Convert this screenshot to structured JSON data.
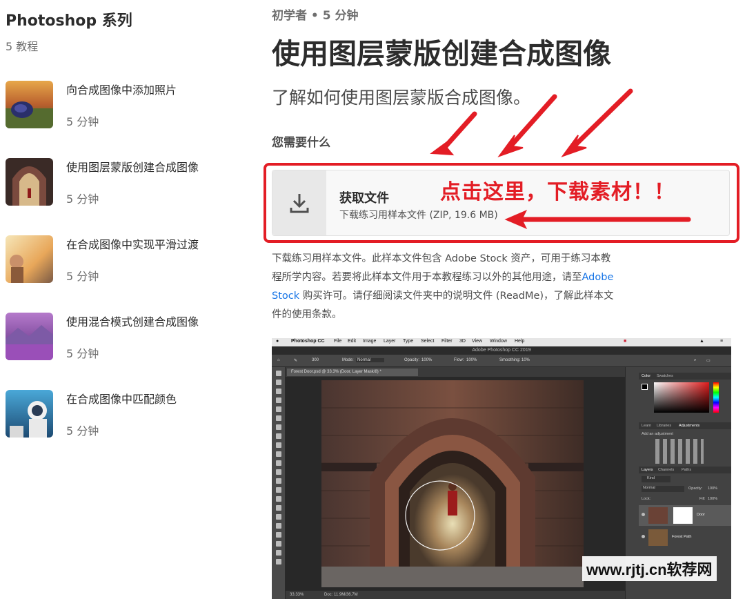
{
  "sidebar": {
    "title": "Photoshop 系列",
    "count": "5 教程",
    "lessons": [
      {
        "title": "向合成图像中添加照片",
        "time": "5 分钟"
      },
      {
        "title": "使用图层蒙版创建合成图像",
        "time": "5 分钟"
      },
      {
        "title": "在合成图像中实现平滑过渡",
        "time": "5 分钟"
      },
      {
        "title": "使用混合模式创建合成图像",
        "time": "5 分钟"
      },
      {
        "title": "在合成图像中匹配颜色",
        "time": "5 分钟"
      }
    ]
  },
  "main": {
    "meta": "初学者 • 5 分钟",
    "title": "使用图层蒙版创建合成图像",
    "lead": "了解如何使用图层蒙版合成图像。",
    "need": "您需要什么",
    "download": {
      "title": "获取文件",
      "subtitle": "下载练习用样本文件 (ZIP, 19.6 MB)",
      "icon": "download-icon"
    },
    "annotation": "点击这里，下载素材！！",
    "description": {
      "part1": "下载练习用样本文件。此样本文件包含 Adobe Stock 资产，可用于练习本教程所学内容。若要将此样本文件用于本教程练习以外的其他用途，请至",
      "link": "Adobe Stock",
      "part2": "购买许可。请仔细阅读文件夹中的说明文件 (ReadMe)，了解此样本文件的使用条款。"
    }
  },
  "ps": {
    "menu": [
      "Photoshop CC",
      "File",
      "Edit",
      "Image",
      "Layer",
      "Type",
      "Select",
      "Filter",
      "3D",
      "View",
      "Window",
      "Help"
    ],
    "window_title": "Adobe Photoshop CC 2019",
    "options": {
      "mode_label": "Mode:",
      "mode_value": "Normal",
      "opacity_label": "Opacity:",
      "opacity_value": "100%",
      "flow_label": "Flow:",
      "flow_value": "100%",
      "smoothing_label": "Smoothing:",
      "smoothing_value": "10%",
      "brush_size": "300"
    },
    "doc_tab": "Forest Door.psd @ 33.3% (Door, Layer Mask/8) *",
    "status_zoom": "33.33%",
    "status_doc": "Doc: 11.9M/36.7M",
    "color_tabs": [
      "Color",
      "Swatches"
    ],
    "adj_tabs": [
      "Learn",
      "Libraries",
      "Adjustments"
    ],
    "adj_label": "Add an adjustment",
    "layer_tabs": [
      "Layers",
      "Channels",
      "Paths"
    ],
    "layer_kind": "Kind",
    "blend_mode": "Normal",
    "opacity_label": "Opacity:",
    "opacity_value": "100%",
    "lock_label": "Lock:",
    "fill_label": "Fill:",
    "fill_value": "100%",
    "layers": [
      {
        "name": "Door"
      },
      {
        "name": "Forest Path"
      }
    ]
  },
  "watermark": "www.rjtj.cn软荐网",
  "colors": {
    "accent_red": "#e31d25",
    "link_blue": "#1473e6"
  }
}
